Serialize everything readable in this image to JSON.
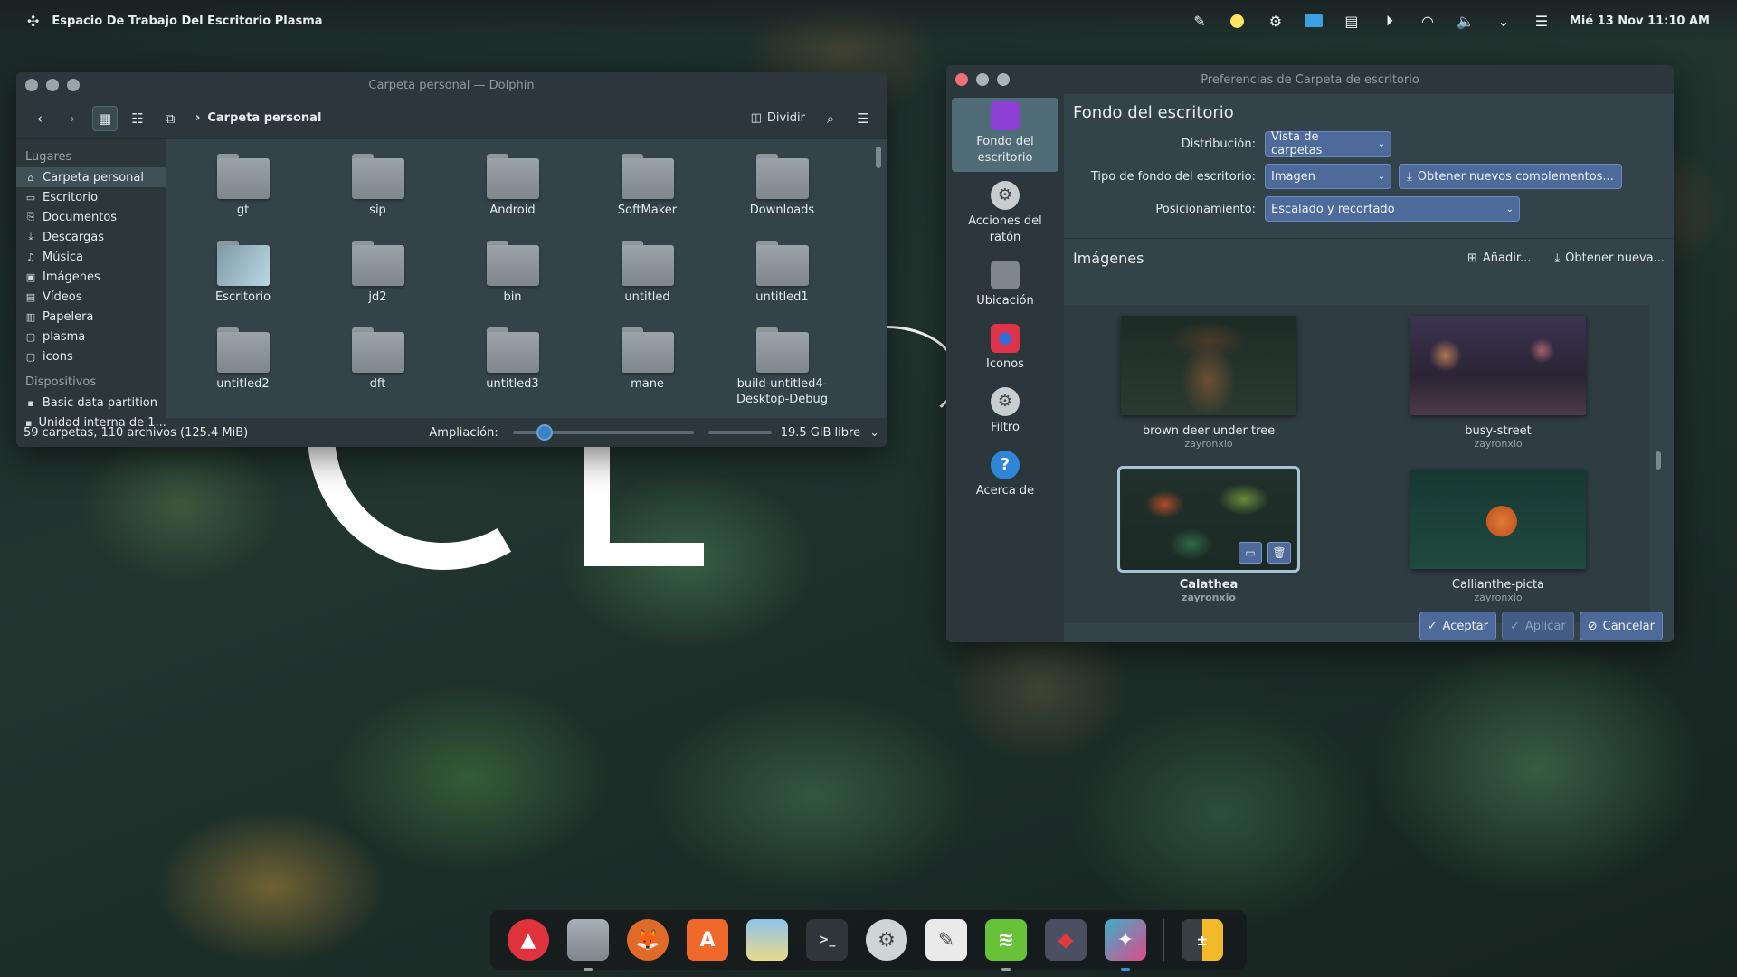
{
  "top_panel": {
    "activity_title": "Espacio De Trabajo Del Escritorio Plasma",
    "tray_icons": [
      "pen-icon",
      "moon-icon",
      "settings-icon",
      "display-icon",
      "clipboard-icon",
      "media-play-icon",
      "wifi-icon",
      "volume-icon",
      "chevron-down-icon",
      "sliders-icon"
    ],
    "clock": "Mié 13 Nov   11:10 AM"
  },
  "dolphin": {
    "title": "Carpeta personal — Dolphin",
    "breadcrumb": "Carpeta personal",
    "split_label": "Dividir",
    "places_header": "Lugares",
    "places": [
      {
        "label": "Carpeta personal",
        "icon": "home-icon"
      },
      {
        "label": "Escritorio",
        "icon": "desktop-icon"
      },
      {
        "label": "Documentos",
        "icon": "documents-icon"
      },
      {
        "label": "Descargas",
        "icon": "downloads-icon"
      },
      {
        "label": "Música",
        "icon": "music-icon"
      },
      {
        "label": "Imágenes",
        "icon": "pictures-icon"
      },
      {
        "label": "Vídeos",
        "icon": "videos-icon"
      },
      {
        "label": "Papelera",
        "icon": "trash-icon"
      },
      {
        "label": "plasma",
        "icon": "folder-icon"
      },
      {
        "label": "icons",
        "icon": "folder-icon"
      }
    ],
    "devices_header": "Dispositivos",
    "devices": [
      {
        "label": "Basic data partition",
        "icon": "drive-icon"
      },
      {
        "label": "Unidad interna de 1...",
        "icon": "drive-icon"
      }
    ],
    "files": [
      "gt",
      "sip",
      "Android",
      "SoftMaker",
      "Downloads",
      "Escritorio",
      "jd2",
      "bin",
      "untitled",
      "untitled1",
      "untitled2",
      "dft",
      "untitled3",
      "mane",
      "build-untitled4-Desktop-Debug"
    ],
    "status_text": "59 carpetas, 110 archivos (125.4 MiB)",
    "zoom_label": "Ampliación:",
    "free_space": "19.5 GiB libre"
  },
  "prefs": {
    "title": "Preferencias de Carpeta de escritorio",
    "categories": [
      {
        "label": "Fondo del escritorio",
        "icon": "wallpaper-icon",
        "color": "#8e3fd6"
      },
      {
        "label": "Acciones del ratón",
        "icon": "mouse-icon",
        "color": "#c8cdd0"
      },
      {
        "label": "Ubicación",
        "icon": "folder-icon",
        "color": "#7d878c"
      },
      {
        "label": "Iconos",
        "icon": "icons-icon",
        "color": "#e0334a"
      },
      {
        "label": "Filtro",
        "icon": "filter-icon",
        "color": "#c8cdd0"
      },
      {
        "label": "Acerca de",
        "icon": "help-icon",
        "color": "#2f86d8"
      }
    ],
    "heading": "Fondo del escritorio",
    "layout_label": "Distribución:",
    "layout_value": "Vista de carpetas",
    "type_label": "Tipo de fondo del escritorio:",
    "type_value": "Imagen",
    "get_plugins": "Obtener nuevos complementos...",
    "position_label": "Posicionamiento:",
    "position_value": "Escalado y recortado",
    "images_heading": "Imágenes",
    "add_label": "Añadir...",
    "get_new_label": "Obtener nueva...",
    "images": [
      {
        "name": "brown deer under tree",
        "author": "zayronxio"
      },
      {
        "name": "busy-street",
        "author": "zayronxio"
      },
      {
        "name": "Calathea",
        "author": "zayronxio"
      },
      {
        "name": "Callianthe-picta",
        "author": "zayronxio"
      }
    ],
    "ok_label": "Aceptar",
    "apply_label": "Aplicar",
    "cancel_label": "Cancelar"
  },
  "dock": {
    "apps": [
      "launcher-rocket-icon",
      "files-icon",
      "firefox-icon",
      "app-store-icon",
      "image-viewer-icon",
      "terminal-icon",
      "system-settings-icon",
      "text-editor-icon",
      "spotify-icon",
      "inkscape-icon",
      "kdenlive-icon",
      "calculator-icon"
    ]
  }
}
